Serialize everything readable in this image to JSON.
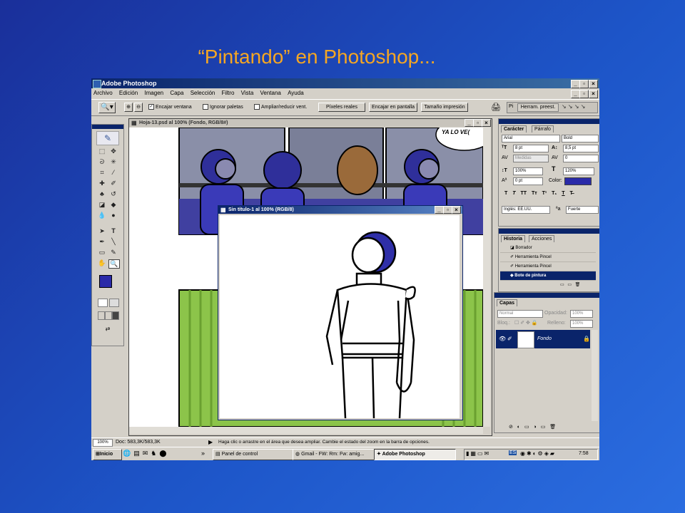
{
  "slide": {
    "title": "“Pintando” en Photoshop..."
  },
  "app": {
    "title": "Adobe Photoshop",
    "menu": [
      "Archivo",
      "Edición",
      "Imagen",
      "Capa",
      "Selección",
      "Filtro",
      "Vista",
      "Ventana",
      "Ayuda"
    ],
    "options": {
      "encajar_ventana": "Encajar ventana",
      "ignorar_paletas": "Ignorar paletas",
      "ampliar_reducir": "Ampliar/reducir vent.",
      "pixeles_reales": "Píxeles reales",
      "encajar_pantalla": "Encajar en pantalla",
      "tamano_impresion": "Tamaño impresión",
      "pi": "Pi",
      "herram_preest": "Herram. preest."
    },
    "doc1": {
      "title": "Hoja-13.psd al 100% (Fondo, RGB/8#)",
      "speech": "YA LO VE("
    },
    "doc2": {
      "title": "Sin título-1 al 100% (RGB/8)"
    },
    "character": {
      "tabs": [
        "Carácter",
        "Párrafo"
      ],
      "font": "Arial",
      "style": "Bold",
      "size": "8 pt",
      "leading": "8,5 pt",
      "kerning": "Medidas",
      "tracking": "0",
      "vscale": "100%",
      "hscale": "120%",
      "baseline": "0 pt",
      "color_label": "Color:",
      "color": "#2a2aa8",
      "language": "Inglés: EE.UU.",
      "aa_icon": "ªa",
      "antialias": "Fuerte"
    },
    "history": {
      "tabs": [
        "Historia",
        "Acciones"
      ],
      "items": [
        "Borrador",
        "Herramienta Pincel",
        "Herramienta Pincel",
        "Bote de pintura"
      ]
    },
    "layers": {
      "tab": "Capas",
      "mode": "Normal",
      "opacity_label": "Opacidad:",
      "opacity": "100%",
      "lock_label": "Bloq.:",
      "fill_label": "Relleno:",
      "fill": "100%",
      "layer_name": "Fondo"
    },
    "status": {
      "zoom": "100%",
      "doc": "Doc: 583,3K/583,3K",
      "hint": "Haga clic o arrastre en el área que desea ampliar. Cambie el estado del zoom en la barra de opciones."
    },
    "taskbar": {
      "start": "Inicio",
      "chevron": "»",
      "tasks": [
        "Panel de control",
        "Gmail - FW: Rm: Fw: amig...",
        "Adobe Photoshop"
      ],
      "lang": "ES",
      "clock": "7:58"
    },
    "colors": {
      "foreground": "#2a2aa8",
      "background": "#ffffff",
      "title_bar": "#0a246a",
      "suit": "#3a3ab8",
      "comic_green": "#8cc44a"
    }
  }
}
